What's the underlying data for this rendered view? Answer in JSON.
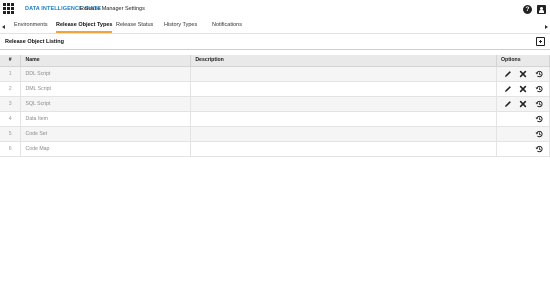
{
  "header": {
    "brand": "DATA INTELLIGENCE SUITE",
    "app_title": "Release Manager Settings",
    "help_glyph": "?",
    "icons": [
      "apps-grid-icon",
      "help-icon",
      "user-icon"
    ]
  },
  "tabs": [
    {
      "label": "Environments"
    },
    {
      "label": "Release Object Types"
    },
    {
      "label": "Release Status"
    },
    {
      "label": "History Types"
    },
    {
      "label": "Notifications"
    }
  ],
  "active_tab": "Release Object Types",
  "section": {
    "title": "Release Object Listing"
  },
  "table": {
    "headers": {
      "num": "#",
      "name": "Name",
      "description": "Description",
      "options": "Options"
    },
    "rows": [
      {
        "num": "1",
        "name": "DDL Script",
        "description": "",
        "edit": true,
        "delete": true,
        "history": true
      },
      {
        "num": "2",
        "name": "DML Script",
        "description": "",
        "edit": true,
        "delete": true,
        "history": true
      },
      {
        "num": "3",
        "name": "SQL Script",
        "description": "",
        "edit": true,
        "delete": true,
        "history": true
      },
      {
        "num": "4",
        "name": "Data Item",
        "description": "",
        "edit": false,
        "delete": false,
        "history": true
      },
      {
        "num": "5",
        "name": "Code Set",
        "description": "",
        "edit": false,
        "delete": false,
        "history": true
      },
      {
        "num": "6",
        "name": "Code Map",
        "description": "",
        "edit": false,
        "delete": false,
        "history": true
      }
    ]
  },
  "colors": {
    "brand": "#1b7fc4",
    "active_tab_underline": "#f2a23a",
    "header_row": "#e9e9e9",
    "icon": "#222222"
  }
}
